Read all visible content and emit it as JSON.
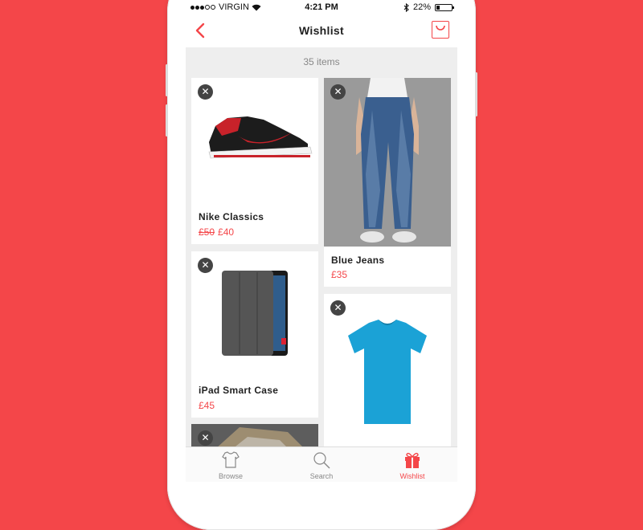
{
  "status": {
    "carrier": "VIRGIN",
    "time": "4:21 PM",
    "battery": "22%",
    "battery_level": 0.22
  },
  "nav": {
    "title": "Wishlist"
  },
  "summary": {
    "count": "35 items"
  },
  "products": [
    {
      "name": "Nike Classics",
      "old_price": "£50",
      "price": "£40"
    },
    {
      "name": "Blue Jeans",
      "price": "£35"
    },
    {
      "name": "iPad Smart Case",
      "price": "£45"
    }
  ],
  "tabs": [
    {
      "label": "Browse",
      "icon": "tshirt-icon"
    },
    {
      "label": "Search",
      "icon": "search-icon"
    },
    {
      "label": "Wishlist",
      "icon": "gift-icon"
    }
  ],
  "colors": {
    "accent": "#f44649",
    "background": "#f44649"
  }
}
